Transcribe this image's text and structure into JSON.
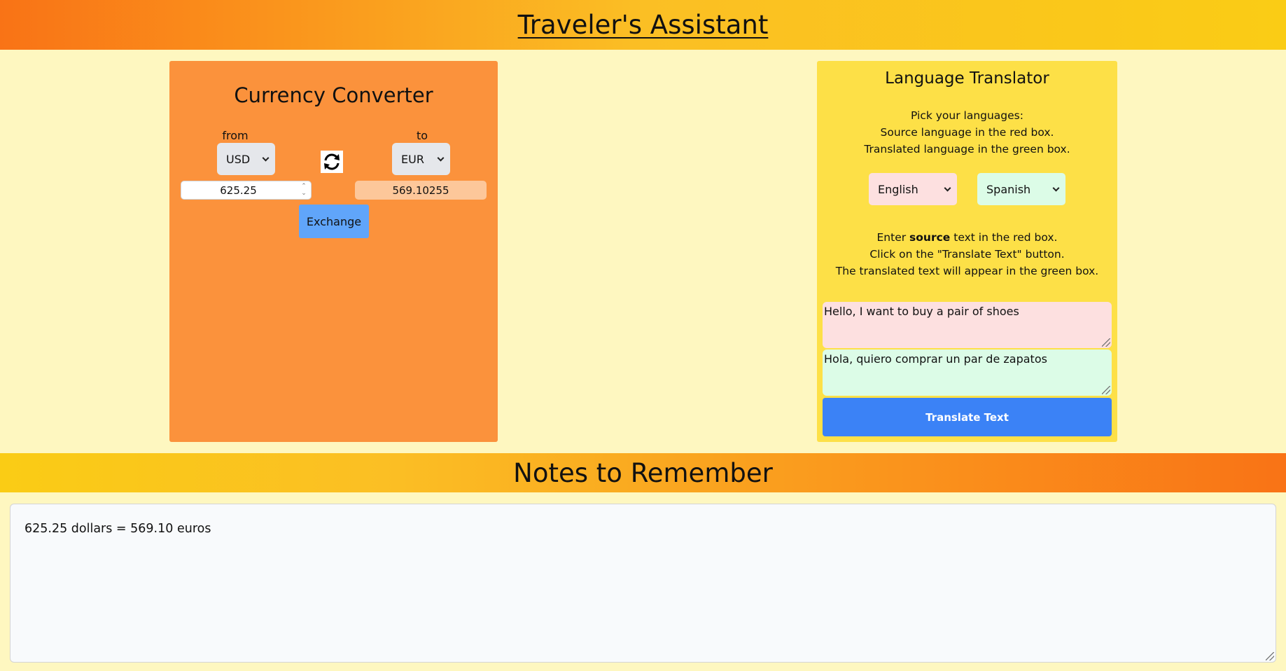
{
  "header": {
    "title": "Traveler's Assistant"
  },
  "currency": {
    "title": "Currency Converter",
    "from_label": "from",
    "to_label": "to",
    "from_currency": "USD",
    "to_currency": "EUR",
    "amount": "625.25",
    "result": "569.10255",
    "exchange_label": "Exchange",
    "swap_icon": "refresh-icon"
  },
  "translator": {
    "title": "Language Translator",
    "pick_lines": [
      "Pick your languages:",
      "Source language in the red box.",
      "Translated language in the green box."
    ],
    "source_language": "English",
    "target_language": "Spanish",
    "enter_prefix": "Enter ",
    "enter_bold": "source",
    "enter_suffix": " text in the red box.",
    "click_line": "Click on the \"Translate Text\" button.",
    "appear_line": "The translated text will appear in the green box.",
    "source_text": "Hello, I want to buy a pair of shoes",
    "translated_text": "Hola, quiero comprar un par de zapatos",
    "translate_label": "Translate Text",
    "colors": {
      "source_bg": "#fde0e0",
      "target_bg": "#dcfce7",
      "button": "#3b82f6"
    }
  },
  "notes": {
    "title": "Notes to Remember",
    "content": "625.25 dollars = 569.10 euros"
  }
}
